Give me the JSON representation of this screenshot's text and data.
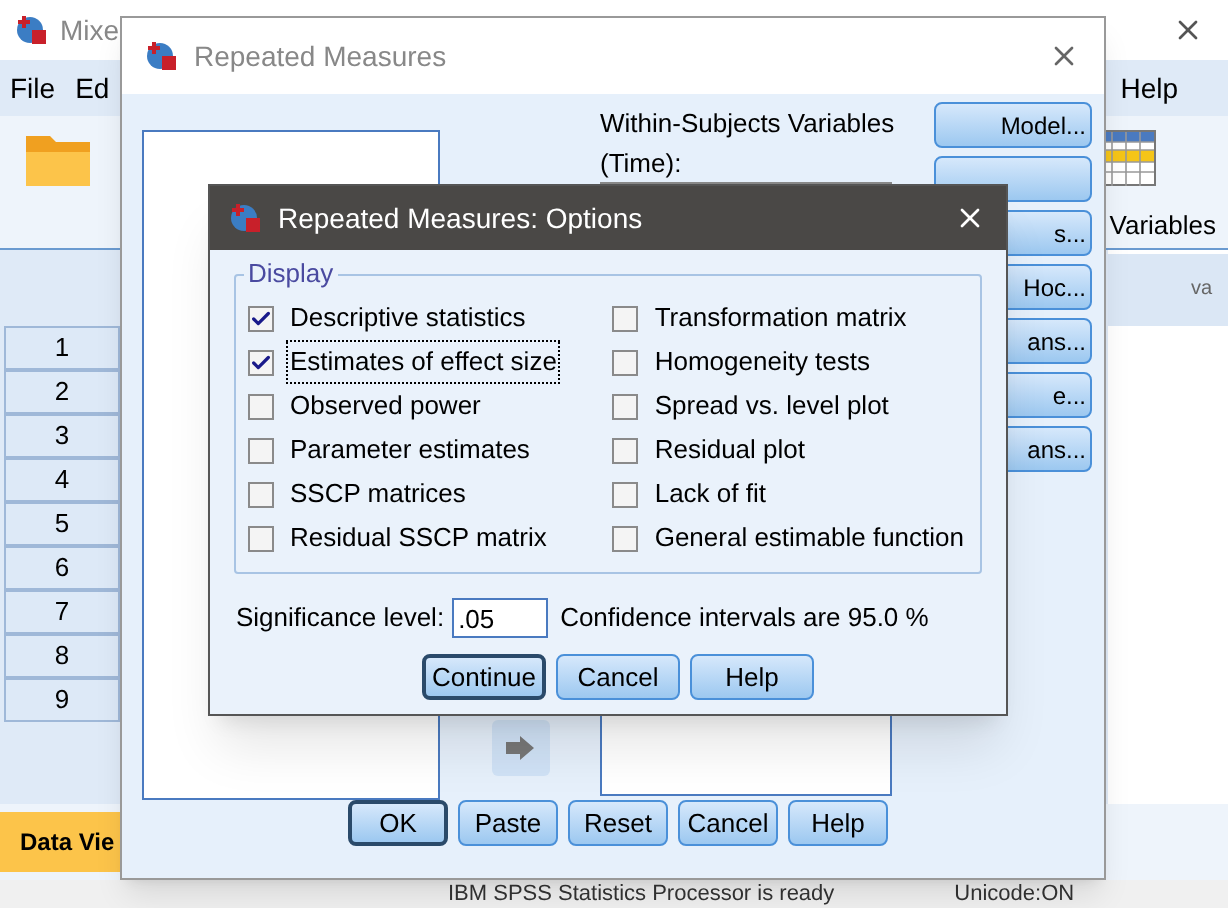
{
  "app": {
    "title": "Mixe",
    "menu": [
      "File",
      "Ed",
      "Help"
    ],
    "panel_tab": "Variables",
    "column_header": "va",
    "row_numbers": [
      "1",
      "2",
      "3",
      "4",
      "5",
      "6",
      "7",
      "8",
      "9"
    ],
    "view_tab": {
      "label": "Data Vie",
      "selected": true
    },
    "status_bar": [
      "IBM SPSS Statistics Processor is ready",
      "Unicode:ON"
    ]
  },
  "dialog": {
    "title": "Repeated Measures",
    "within_label": "Within-Subjects Variables",
    "within_sub": "(Time):",
    "side_buttons": [
      {
        "kind": "labeled",
        "label": "Model..."
      },
      {
        "kind": "covered"
      },
      {
        "kind": "labeled",
        "label": "s..."
      },
      {
        "kind": "labeled",
        "label": "Hoc..."
      },
      {
        "kind": "labeled",
        "label": "ans..."
      },
      {
        "kind": "labeled",
        "label": "e..."
      },
      {
        "kind": "labeled",
        "label": "ans..."
      }
    ],
    "buttons": [
      {
        "label": "OK",
        "default": true
      },
      {
        "label": "Paste",
        "default": false
      },
      {
        "label": "Reset",
        "default": false
      },
      {
        "label": "Cancel",
        "default": false
      },
      {
        "label": "Help",
        "default": false
      }
    ]
  },
  "options": {
    "title": "Repeated Measures: Options",
    "group": "Display",
    "checks": [
      {
        "label": "Descriptive statistics",
        "checked": true,
        "focused": false
      },
      {
        "label": "Estimates of effect size",
        "checked": true,
        "focused": true
      },
      {
        "label": "Observed power",
        "checked": false,
        "focused": false
      },
      {
        "label": "Parameter estimates",
        "checked": false,
        "focused": false
      },
      {
        "label": "SSCP matrices",
        "checked": false,
        "focused": false
      },
      {
        "label": "Residual SSCP matrix",
        "checked": false,
        "focused": false
      },
      {
        "label": "Transformation matrix",
        "checked": false,
        "focused": false
      },
      {
        "label": "Homogeneity tests",
        "checked": false,
        "focused": false
      },
      {
        "label": "Spread vs. level plot",
        "checked": false,
        "focused": false
      },
      {
        "label": "Residual plot",
        "checked": false,
        "focused": false
      },
      {
        "label": "Lack of fit",
        "checked": false,
        "focused": false
      },
      {
        "label": "General estimable function",
        "checked": false,
        "focused": false
      }
    ],
    "significance": {
      "label": "Significance level:",
      "value": ".05"
    },
    "confidence": "Confidence intervals are 95.0 %",
    "buttons": [
      {
        "label": "Continue",
        "default": true
      },
      {
        "label": "Cancel",
        "default": false
      },
      {
        "label": "Help",
        "default": false
      }
    ]
  }
}
